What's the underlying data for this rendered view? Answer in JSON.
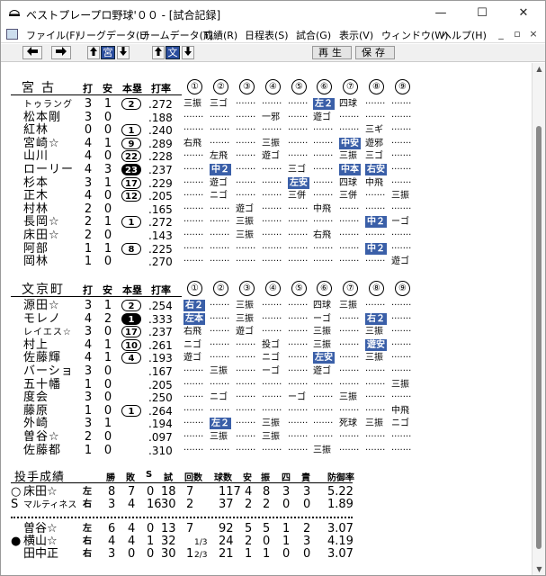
{
  "window": {
    "title": "ベストプレープロ野球'００ - [試合記録]",
    "minimize": "—",
    "maximize": "☐",
    "close": "✕"
  },
  "menu": [
    "ファイル(F)",
    "リーグデータ(L)",
    "チームデータ(T)",
    "成績(R)",
    "日程表(S)",
    "試合(G)",
    "表示(V)",
    "ウィンドウ(W)",
    "ヘルプ(H)"
  ],
  "mdi_controls": [
    "_",
    "▫",
    "×"
  ],
  "toolbar": {
    "left": "◆",
    "right": "◆",
    "team1": "宮",
    "team2": "文",
    "play": "再生",
    "save": "保存"
  },
  "icons": {
    "app": "baseball-icon",
    "mdi": "document-icon",
    "up": "up-arrow-icon",
    "down": "down-arrow-icon"
  },
  "headers": {
    "ab": "打",
    "h": "安",
    "hr": "本塁",
    "avg": "打率",
    "innings": [
      "①",
      "②",
      "③",
      "④",
      "⑤",
      "⑥",
      "⑦",
      "⑧",
      "⑨"
    ]
  },
  "team_away": {
    "name": "宮古",
    "batters": [
      {
        "name": "トゥラング",
        "small": true,
        "ab": "3",
        "h": "1",
        "hr": "2",
        "fill": false,
        "avg": ".272",
        "inn": [
          [
            "三振",
            0
          ],
          [
            "三ゴ",
            0
          ],
          null,
          null,
          null,
          [
            "左２",
            1
          ],
          [
            "四球",
            0
          ],
          null,
          null
        ]
      },
      {
        "name": "松本剛",
        "ab": "3",
        "h": "0",
        "hr": "",
        "avg": ".188",
        "inn": [
          null,
          null,
          null,
          [
            "一邪",
            0
          ],
          null,
          [
            "遊ゴ",
            0
          ],
          null,
          null,
          null
        ]
      },
      {
        "name": "紅林",
        "ab": "0",
        "h": "0",
        "hr": "1",
        "fill": false,
        "avg": ".240",
        "inn": [
          null,
          null,
          null,
          null,
          null,
          null,
          null,
          [
            "三ギ",
            0
          ],
          null
        ]
      },
      {
        "name": "宮崎☆",
        "ab": "4",
        "h": "1",
        "hr": "9",
        "fill": false,
        "avg": ".289",
        "inn": [
          [
            "右飛",
            0
          ],
          null,
          null,
          [
            "三振",
            0
          ],
          null,
          null,
          [
            "中安",
            1
          ],
          [
            "遊邪",
            0
          ],
          null
        ]
      },
      {
        "name": "山川",
        "ab": "4",
        "h": "0",
        "hr": "22",
        "fill": false,
        "avg": ".228",
        "inn": [
          null,
          [
            "左飛",
            0
          ],
          null,
          [
            "遊ゴ",
            0
          ],
          null,
          null,
          [
            "三振",
            0
          ],
          [
            "三ゴ",
            0
          ],
          null
        ]
      },
      {
        "name": "ローリー",
        "ab": "4",
        "h": "3",
        "hr": "23",
        "fill": true,
        "avg": ".237",
        "inn": [
          null,
          [
            "中２",
            1
          ],
          null,
          null,
          [
            "三ゴ",
            0
          ],
          null,
          [
            "中本",
            1
          ],
          [
            "右安",
            1
          ],
          null
        ]
      },
      {
        "name": "杉本",
        "ab": "3",
        "h": "1",
        "hr": "17",
        "fill": false,
        "avg": ".229",
        "inn": [
          null,
          [
            "遊ゴ",
            0
          ],
          null,
          null,
          [
            "左安",
            1
          ],
          null,
          [
            "四球",
            0
          ],
          [
            "中飛",
            0
          ],
          null
        ]
      },
      {
        "name": "正木",
        "ab": "4",
        "h": "0",
        "hr": "12",
        "fill": false,
        "avg": ".205",
        "inn": [
          null,
          [
            "ニゴ",
            0
          ],
          null,
          null,
          [
            "三併",
            0
          ],
          null,
          [
            "三併",
            0
          ],
          null,
          [
            "三振",
            0
          ]
        ]
      },
      {
        "name": "村林",
        "ab": "2",
        "h": "0",
        "hr": "",
        "avg": ".165",
        "inn": [
          null,
          null,
          [
            "遊ゴ",
            0
          ],
          null,
          null,
          [
            "中飛",
            0
          ],
          null,
          null,
          null
        ]
      },
      {
        "name": "長岡☆",
        "ab": "2",
        "h": "1",
        "hr": "1",
        "fill": false,
        "avg": ".272",
        "inn": [
          null,
          null,
          [
            "三振",
            0
          ],
          null,
          null,
          null,
          null,
          [
            "中２",
            1
          ],
          [
            "ーゴ",
            0
          ]
        ]
      },
      {
        "name": "床田☆",
        "ab": "2",
        "h": "0",
        "hr": "",
        "avg": ".143",
        "inn": [
          null,
          null,
          [
            "三振",
            0
          ],
          null,
          null,
          [
            "右飛",
            0
          ],
          null,
          null,
          null
        ]
      },
      {
        "name": "阿部",
        "ab": "1",
        "h": "1",
        "hr": "8",
        "fill": false,
        "avg": ".225",
        "inn": [
          null,
          null,
          null,
          null,
          null,
          null,
          null,
          [
            "中２",
            1
          ],
          null
        ]
      },
      {
        "name": "岡林",
        "ab": "1",
        "h": "0",
        "hr": "",
        "avg": ".270",
        "inn": [
          null,
          null,
          null,
          null,
          null,
          null,
          null,
          null,
          [
            "遊ゴ",
            0
          ]
        ]
      }
    ]
  },
  "team_home": {
    "name": "文京町",
    "batters": [
      {
        "name": "源田☆",
        "ab": "3",
        "h": "1",
        "hr": "2",
        "fill": false,
        "avg": ".254",
        "inn": [
          [
            "右２",
            1
          ],
          null,
          [
            "三振",
            0
          ],
          null,
          null,
          [
            "四球",
            0
          ],
          [
            "三振",
            0
          ],
          null,
          null
        ]
      },
      {
        "name": "モレノ",
        "ab": "4",
        "h": "2",
        "hr": "1",
        "fill": true,
        "avg": ".333",
        "inn": [
          [
            "左本",
            1
          ],
          null,
          [
            "三振",
            0
          ],
          null,
          null,
          [
            "ーゴ",
            0
          ],
          null,
          [
            "右２",
            1
          ],
          null
        ]
      },
      {
        "name": "レイエス☆",
        "small": true,
        "ab": "3",
        "h": "0",
        "hr": "17",
        "fill": false,
        "avg": ".237",
        "inn": [
          [
            "右飛",
            0
          ],
          null,
          [
            "遊ゴ",
            0
          ],
          null,
          null,
          [
            "三振",
            0
          ],
          null,
          [
            "三振",
            0
          ],
          null
        ]
      },
      {
        "name": "村上",
        "ab": "4",
        "h": "1",
        "hr": "10",
        "fill": false,
        "avg": ".261",
        "inn": [
          [
            "ニゴ",
            0
          ],
          null,
          null,
          [
            "投ゴ",
            0
          ],
          null,
          [
            "三振",
            0
          ],
          null,
          [
            "遊安",
            1
          ],
          null
        ]
      },
      {
        "name": "佐藤輝",
        "ab": "4",
        "h": "1",
        "hr": "4",
        "fill": false,
        "avg": ".193",
        "inn": [
          [
            "遊ゴ",
            0
          ],
          null,
          null,
          [
            "ニゴ",
            0
          ],
          null,
          [
            "左安",
            1
          ],
          null,
          [
            "三振",
            0
          ],
          null
        ]
      },
      {
        "name": "バーショ",
        "ab": "3",
        "h": "0",
        "hr": "",
        "avg": ".167",
        "inn": [
          null,
          [
            "三振",
            0
          ],
          null,
          [
            "ーゴ",
            0
          ],
          null,
          [
            "遊ゴ",
            0
          ],
          null,
          null,
          null
        ]
      },
      {
        "name": "五十幡",
        "ab": "1",
        "h": "0",
        "hr": "",
        "avg": ".205",
        "inn": [
          null,
          null,
          null,
          null,
          null,
          null,
          null,
          null,
          [
            "三振",
            0
          ]
        ]
      },
      {
        "name": "度会",
        "ab": "3",
        "h": "0",
        "hr": "",
        "avg": ".250",
        "inn": [
          null,
          [
            "ニゴ",
            0
          ],
          null,
          null,
          [
            "ーゴ",
            0
          ],
          null,
          [
            "三振",
            0
          ],
          null,
          null
        ]
      },
      {
        "name": "藤原",
        "ab": "1",
        "h": "0",
        "hr": "1",
        "fill": false,
        "avg": ".264",
        "inn": [
          null,
          null,
          null,
          null,
          null,
          null,
          null,
          null,
          [
            "中飛",
            0
          ]
        ]
      },
      {
        "name": "外崎",
        "ab": "3",
        "h": "1",
        "hr": "",
        "avg": ".194",
        "inn": [
          null,
          [
            "左２",
            1
          ],
          null,
          [
            "三振",
            0
          ],
          null,
          null,
          [
            "死球",
            0
          ],
          [
            "三振",
            0
          ],
          [
            "ニゴ",
            0
          ]
        ]
      },
      {
        "name": "曽谷☆",
        "ab": "2",
        "h": "0",
        "hr": "",
        "avg": ".097",
        "inn": [
          null,
          [
            "三振",
            0
          ],
          null,
          [
            "三振",
            0
          ],
          null,
          null,
          null,
          null,
          null
        ]
      },
      {
        "name": "佐藤都",
        "ab": "1",
        "h": "0",
        "hr": "",
        "avg": ".310",
        "inn": [
          null,
          null,
          null,
          null,
          null,
          [
            "三振",
            0
          ],
          null,
          null,
          null
        ]
      }
    ]
  },
  "pitching": {
    "title": "投手成績",
    "headers": [
      "勝",
      "敗",
      "S",
      "試",
      "回数",
      "球数",
      "安",
      "振",
      "四",
      "責",
      "防御率"
    ],
    "away": [
      {
        "mark": "○",
        "name": "床田☆",
        "small": false,
        "lr": "左",
        "w": "8",
        "l": "7",
        "s": "0",
        "g": "18",
        "ip": "7",
        "frac": "",
        "np": "117",
        "h": "4",
        "so": "8",
        "bb": "3",
        "er": "3",
        "era": "5.22"
      },
      {
        "mark": "S",
        "name": "マルティネス",
        "small": true,
        "lr": "右",
        "w": "3",
        "l": "4",
        "s": "16",
        "g": "30",
        "ip": "2",
        "frac": "",
        "np": "37",
        "h": "2",
        "so": "2",
        "bb": "0",
        "er": "0",
        "era": "1.89"
      }
    ],
    "home": [
      {
        "mark": "",
        "name": "曽谷☆",
        "small": false,
        "lr": "左",
        "w": "6",
        "l": "4",
        "s": "0",
        "g": "13",
        "ip": "7",
        "frac": "",
        "np": "92",
        "h": "5",
        "so": "5",
        "bb": "1",
        "er": "2",
        "era": "3.07"
      },
      {
        "mark": "●",
        "name": "横山☆",
        "small": false,
        "lr": "右",
        "w": "4",
        "l": "4",
        "s": "1",
        "g": "32",
        "ip": "",
        "frac": "1/3",
        "np": "24",
        "h": "2",
        "so": "0",
        "bb": "1",
        "er": "3",
        "era": "4.19"
      },
      {
        "mark": "",
        "name": "田中正",
        "small": false,
        "lr": "右",
        "w": "3",
        "l": "0",
        "s": "0",
        "g": "30",
        "ip": "1",
        "frac": "2/3",
        "np": "21",
        "h": "1",
        "so": "1",
        "bb": "0",
        "er": "0",
        "era": "3.07"
      }
    ]
  }
}
